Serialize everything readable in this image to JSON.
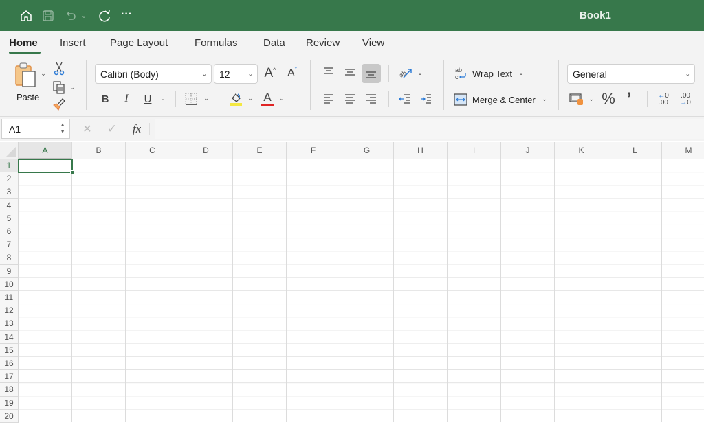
{
  "titlebar": {
    "title": "Book1",
    "icons": [
      "home-icon",
      "save-icon",
      "undo-icon",
      "undo-dropdown-icon",
      "redo-icon",
      "more-icon"
    ],
    "more_label": "···"
  },
  "tabs": [
    {
      "label": "Home",
      "active": true
    },
    {
      "label": "Insert"
    },
    {
      "label": "Page Layout"
    },
    {
      "label": "Formulas"
    },
    {
      "label": "Data"
    },
    {
      "label": "Review"
    },
    {
      "label": "View"
    }
  ],
  "ribbon": {
    "clipboard": {
      "paste_label": "Paste"
    },
    "font": {
      "family": "Calibri (Body)",
      "size": "12",
      "bold": "B",
      "italic": "I",
      "underline": "U",
      "grow": "A",
      "shrink": "A",
      "font_color_glyph": "A",
      "highlight_color": "#f4e842",
      "font_color": "#e02424"
    },
    "alignment": {
      "wrap_text": "Wrap Text",
      "merge_center": "Merge & Center",
      "wrap_glyph": "ab",
      "orientation_glyph": "ab"
    },
    "number": {
      "format": "General",
      "percent": "%",
      "comma": "’",
      "inc_decimal_top": "0",
      "inc_decimal_bottom": ".00",
      "dec_decimal_top": ".00",
      "dec_decimal_bottom": "0"
    }
  },
  "formula_bar": {
    "name_box": "A1",
    "cancel": "✕",
    "enter": "✓",
    "fx": "fx",
    "value": ""
  },
  "sheet": {
    "columns": [
      "A",
      "B",
      "C",
      "D",
      "E",
      "F",
      "G",
      "H",
      "I",
      "J",
      "K",
      "L",
      "M"
    ],
    "rows": [
      "1",
      "2",
      "3",
      "4",
      "5",
      "6",
      "7",
      "8",
      "9",
      "10",
      "11",
      "12",
      "13",
      "14",
      "15",
      "16",
      "17",
      "18",
      "19",
      "20"
    ],
    "active_cell": "A1",
    "accent": "#37784b"
  }
}
